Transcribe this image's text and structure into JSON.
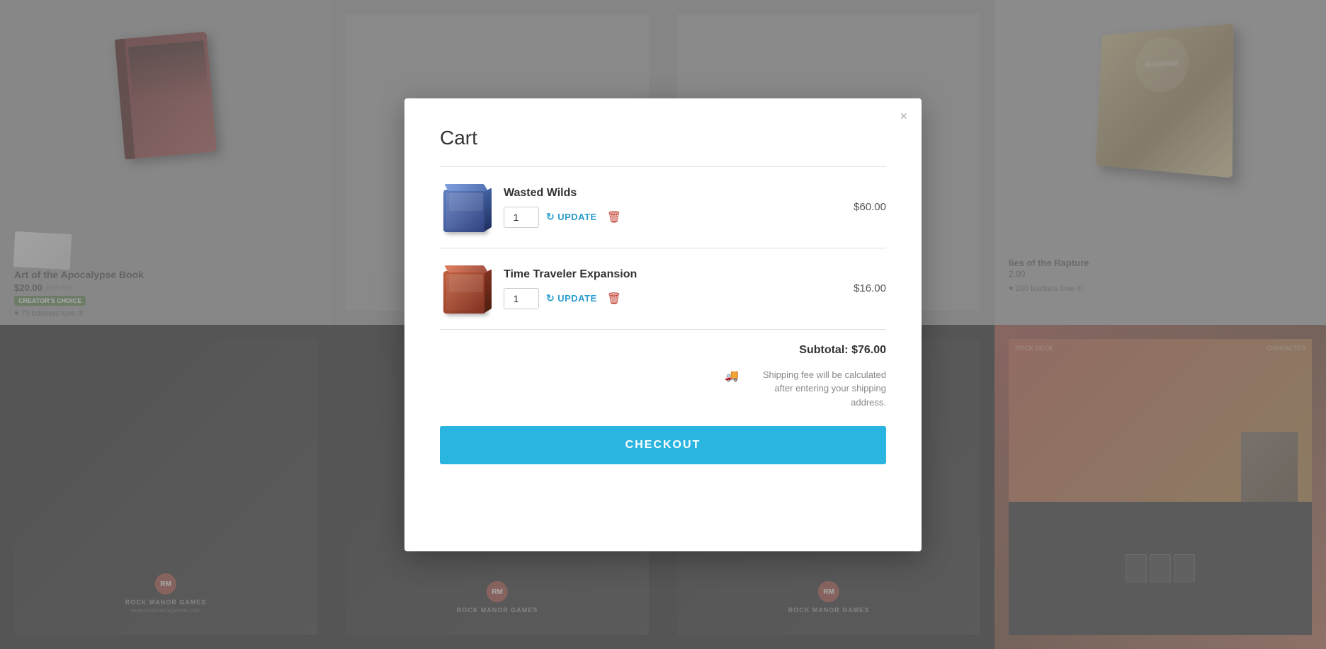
{
  "modal": {
    "title": "Cart",
    "close_label": "×"
  },
  "cart": {
    "items": [
      {
        "id": "wasted-wilds",
        "name": "Wasted Wilds",
        "quantity": 1,
        "price": "$60.00",
        "update_label": "UPDATE",
        "img_alt": "Wasted Wilds box"
      },
      {
        "id": "time-traveler",
        "name": "Time Traveler Expansion",
        "quantity": 1,
        "price": "$16.00",
        "update_label": "UPDATE",
        "img_alt": "Time Traveler Expansion box"
      }
    ],
    "subtotal_label": "Subtotal:",
    "subtotal_value": "$76.00",
    "shipping_note": "Shipping fee will be calculated after entering your shipping address.",
    "checkout_label": "CHECKOUT"
  },
  "background": {
    "products": [
      {
        "name": "Art of the Apocalypse Book",
        "price": "$20.00",
        "price_old": "$20.00",
        "badge": "CREATOR'S CHOICE",
        "backers": "79 backers love it!"
      },
      {
        "name": "",
        "price": "",
        "badge": "",
        "backers": ""
      },
      {
        "name": "Allies of the Rapture",
        "price": "2.00",
        "badge": "",
        "backers": "200 backers love it!"
      },
      {
        "name": "",
        "price": "",
        "badge": "",
        "backers": ""
      }
    ],
    "rock_manor_label": "ROCK MANOR GAMES",
    "rm_url": "www.rockmanorgames.com"
  },
  "icons": {
    "close": "×",
    "update": "↻",
    "delete": "🗑",
    "truck": "🚚",
    "heart": "♥"
  }
}
